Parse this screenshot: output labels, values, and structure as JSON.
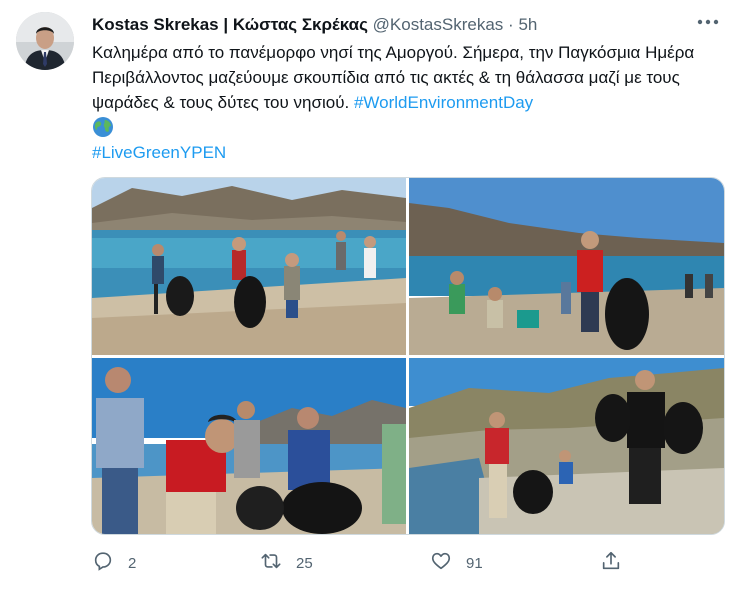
{
  "user": {
    "display_name": "Kostas Skrekas | Κώστας Σκρέκας",
    "handle": "@KostasSkrekas",
    "separator": "·",
    "time": "5h"
  },
  "tweet": {
    "text": "Καλημέρα από το πανέμορφο νησί της Αμοργού. Σήμερα, την Παγκόσμια Ημέρα Περιβάλλοντος μαζεύουμε σκουπίδια από τις ακτές & τη θάλασσα μαζί με τους ψαράδες & τους δύτες του νησιού.",
    "hashtag1": "#WorldEnvironmentDay",
    "emoji": "globe-icon",
    "hashtag2": "#LiveGreenYPEN"
  },
  "actions": {
    "reply_count": "2",
    "retweet_count": "25",
    "like_count": "91"
  },
  "colors": {
    "link": "#1d9bf0",
    "secondary_text": "#536471"
  }
}
